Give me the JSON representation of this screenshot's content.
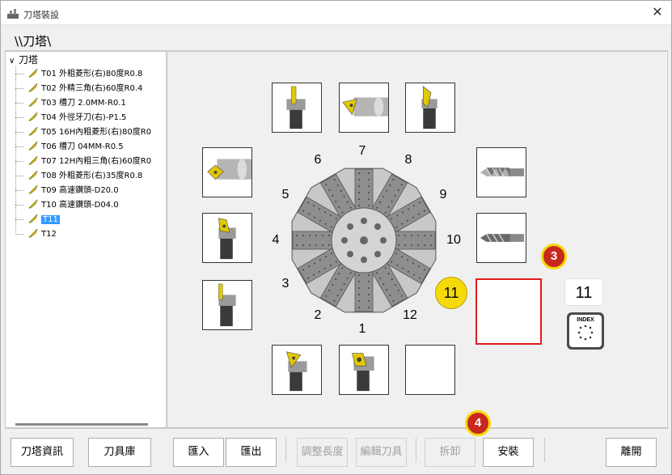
{
  "window": {
    "title": "刀塔裝設",
    "close_glyph": "✕"
  },
  "path": "\\\\刀塔\\",
  "tree": {
    "root_label": "刀塔",
    "items": [
      {
        "label": "T01 外粗菱形(右)80度R0.8",
        "selected": false
      },
      {
        "label": "T02 外精三角(右)60度R0.4",
        "selected": false
      },
      {
        "label": "T03 槽刀 2.0MM-R0.1",
        "selected": false
      },
      {
        "label": "T04 外徑牙刀(右)-P1.5",
        "selected": false
      },
      {
        "label": "T05 16H內粗菱形(右)80度R0",
        "selected": false
      },
      {
        "label": "T06 槽刀 04MM-R0.5",
        "selected": false
      },
      {
        "label": "T07 12H內粗三角(右)60度R0",
        "selected": false
      },
      {
        "label": "T08 外粗菱形(右)35度R0.8",
        "selected": false
      },
      {
        "label": "T09 高速鑽頭-D20.0",
        "selected": false
      },
      {
        "label": "T10 高速鑽頭-D04.0",
        "selected": false
      },
      {
        "label": "T11",
        "selected": true
      },
      {
        "label": "T12",
        "selected": false
      }
    ]
  },
  "turret": {
    "numbers": [
      "1",
      "2",
      "3",
      "4",
      "5",
      "6",
      "7",
      "8",
      "9",
      "10",
      "11",
      "12"
    ],
    "current_position": "11"
  },
  "annotations": {
    "marker3": "3",
    "marker4": "4"
  },
  "index": {
    "value": "11",
    "button_label": "INDEX"
  },
  "buttons": {
    "turret_info": "刀塔資訊",
    "tool_library": "刀具庫",
    "import": "匯入",
    "export": "匯出",
    "adjust_length": "調整長度",
    "edit_tool": "編輯刀具",
    "remove": "拆卸",
    "install": "安裝",
    "leave": "離開"
  },
  "colors": {
    "selection": "#3399ff",
    "target_border": "#e21b1b",
    "badge_yellow": "#f5d90a",
    "badge_red": "#c8281e"
  }
}
